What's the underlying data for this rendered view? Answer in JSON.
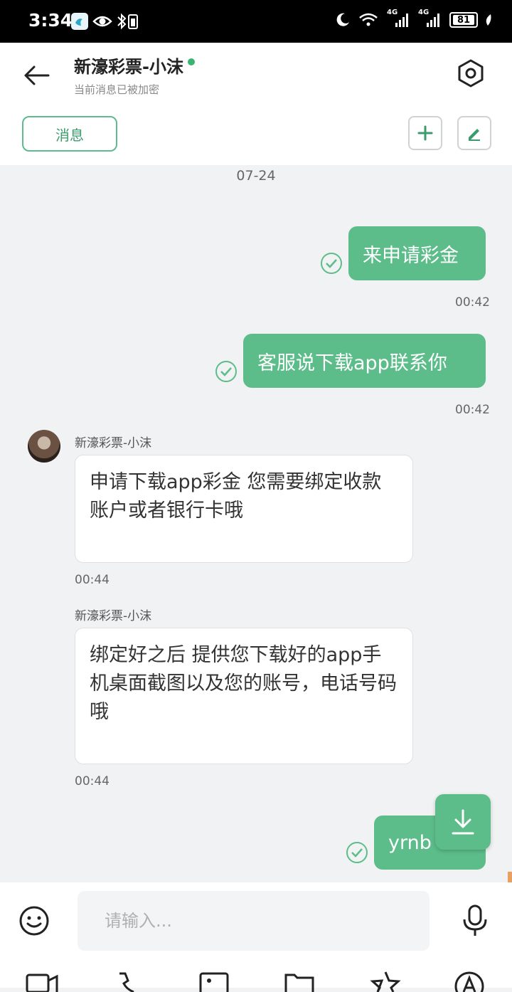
{
  "status": {
    "time": "3:34",
    "network_label": "4G",
    "network_label_2": "4G",
    "battery": "81"
  },
  "header": {
    "title": "新濠彩票-小沫",
    "subtitle": "当前消息已被加密",
    "tab_label": "消息",
    "colors": {
      "accent": "#5cbd8a",
      "online": "#3cb371"
    }
  },
  "chat": {
    "date": "07-24",
    "messages": [
      {
        "direction": "out",
        "text": "来申请彩金",
        "time": "00:42",
        "status": "check-circle-icon"
      },
      {
        "direction": "out",
        "text": "客服说下载app联系你",
        "time": "00:42",
        "status": "check-circle-icon"
      },
      {
        "direction": "in",
        "sender": "新濠彩票-小沫",
        "text": "申请下载app彩金 您需要绑定收款账户或者银行卡哦",
        "time": "00:44"
      },
      {
        "direction": "in",
        "sender": "新濠彩票-小沫",
        "text": "绑定好之后 提供您下载好的app手机桌面截图以及您的账号，电话号码哦",
        "time": "00:44"
      },
      {
        "direction": "out",
        "text": "yrnb",
        "status": "check-circle-icon"
      }
    ]
  },
  "input": {
    "placeholder": "请输入..."
  },
  "toolbar": {
    "icons": [
      "video-icon",
      "phone-icon",
      "image-icon",
      "folder-icon",
      "star-icon",
      "font-icon"
    ]
  }
}
